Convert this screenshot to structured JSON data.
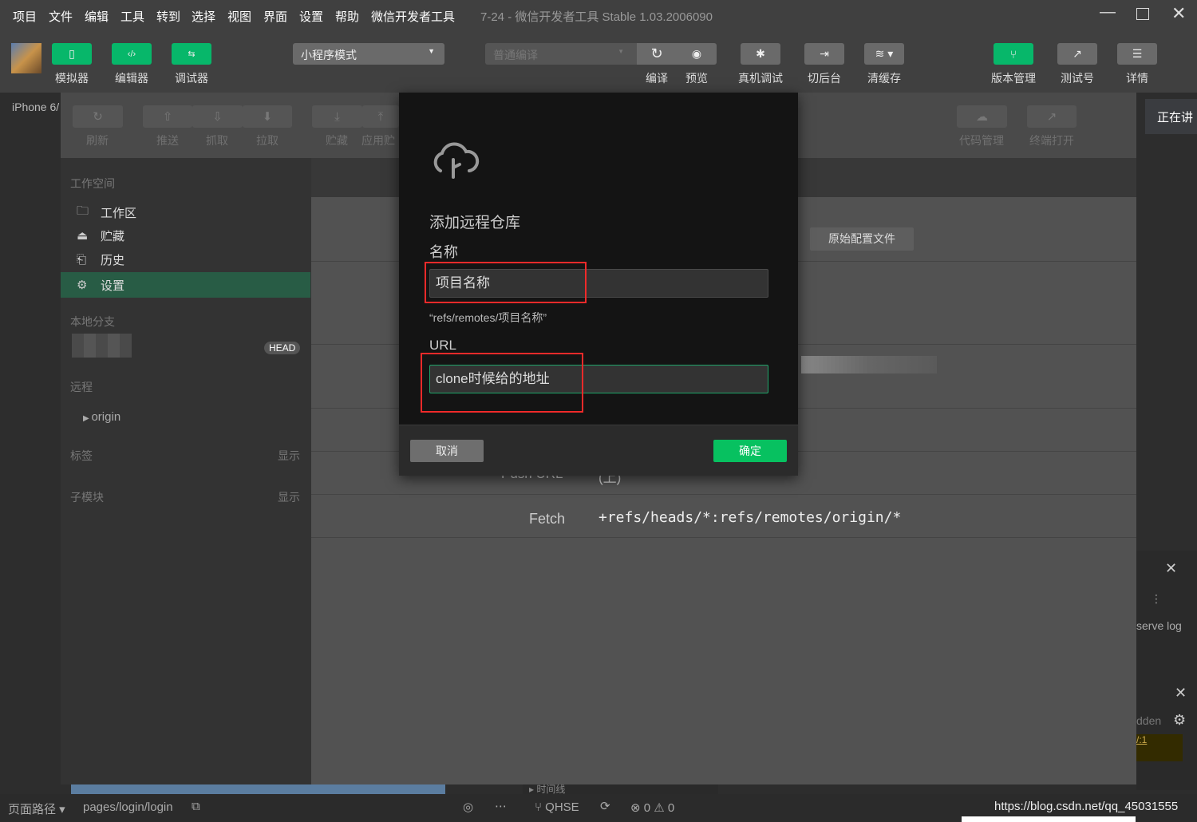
{
  "menu": [
    "项目",
    "文件",
    "编辑",
    "工具",
    "转到",
    "选择",
    "视图",
    "界面",
    "设置",
    "帮助",
    "微信开发者工具"
  ],
  "window_title": "7-24 - 微信开发者工具 Stable 1.03.2006090",
  "toolbar": {
    "simulator": "模拟器",
    "editor": "编辑器",
    "debugger": "调试器",
    "mode_select": "小程序模式",
    "compile_select": "普通编译",
    "compile": "编译",
    "preview": "预览",
    "remote_debug": "真机调试",
    "background": "切后台",
    "clear_cache": "清缓存",
    "version_mgmt": "版本管理",
    "test_account": "测试号",
    "details": "详情"
  },
  "device": "iPhone 6/",
  "right_tab": "正在讲",
  "git_toolbar": {
    "refresh": "刷新",
    "push": "推送",
    "fetch": "抓取",
    "pull": "拉取",
    "stash": "贮藏",
    "apply_stash": "应用贮",
    "code_mgmt": "代码管理",
    "terminal": "终端打开"
  },
  "sidebar": {
    "workspace": "工作空间",
    "items": [
      {
        "label": "工作区",
        "icon": "folder-icon"
      },
      {
        "label": "贮藏",
        "icon": "stash-icon"
      },
      {
        "label": "历史",
        "icon": "history-icon"
      },
      {
        "label": "设置",
        "icon": "gear-icon"
      }
    ],
    "local_branch": "本地分支",
    "head_badge": "HEAD",
    "remote": "远程",
    "origin": "origin",
    "tags": "标签",
    "tags_show": "显示",
    "submodules": "子模块",
    "submodules_show": "显示"
  },
  "main": {
    "raw_config": "原始配置文件",
    "push_url_label": "Push URL",
    "push_url_value": "(上)",
    "fetch_label": "Fetch",
    "fetch_value": "+refs/heads/*:refs/remotes/origin/*"
  },
  "dialog": {
    "title": "添加远程仓库",
    "name_label": "名称",
    "name_value": "项目名称",
    "ref_hint": "“refs/remotes/项目名称”",
    "url_label": "URL",
    "url_value": "clone时候给的地址",
    "cancel": "取消",
    "confirm": "确定"
  },
  "devtools": {
    "preserve_log": "serve log",
    "hidden": "dden",
    "link": "/:1"
  },
  "timeline": "时间线",
  "status": {
    "page_path": "页面路径",
    "path": "pages/login/login",
    "branch": "QHSE",
    "errors": "0",
    "warnings": "0",
    "watermark": "https://blog.csdn.net/qq_45031555"
  },
  "colors": {
    "accent": "#07b76a",
    "active_item": "#285c45",
    "annotation": "#f02a2a"
  }
}
